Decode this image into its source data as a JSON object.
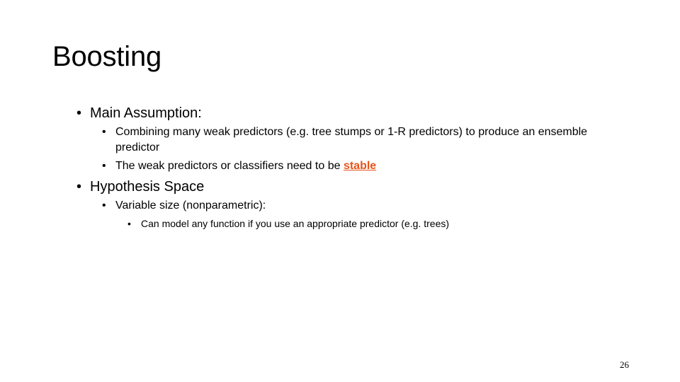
{
  "slide": {
    "title": "Boosting",
    "page_number": "26",
    "bullets": [
      {
        "text": "Main Assumption:",
        "children": [
          {
            "text": "Combining many weak predictors (e.g. tree stumps or 1-R predictors) to produce an ensemble predictor"
          },
          {
            "text_before": "The weak predictors or classifiers need to be ",
            "emphasis": "stable"
          }
        ]
      },
      {
        "text": "Hypothesis Space",
        "children": [
          {
            "text": "Variable size (nonparametric):",
            "children": [
              {
                "text": "Can model any function if you use an appropriate predictor (e.g. trees)"
              }
            ]
          }
        ]
      }
    ]
  },
  "colors": {
    "emphasis": "#e8541a",
    "text": "#000000",
    "background": "#ffffff"
  },
  "icons": {
    "bullet": "bullet-dot-icon"
  }
}
